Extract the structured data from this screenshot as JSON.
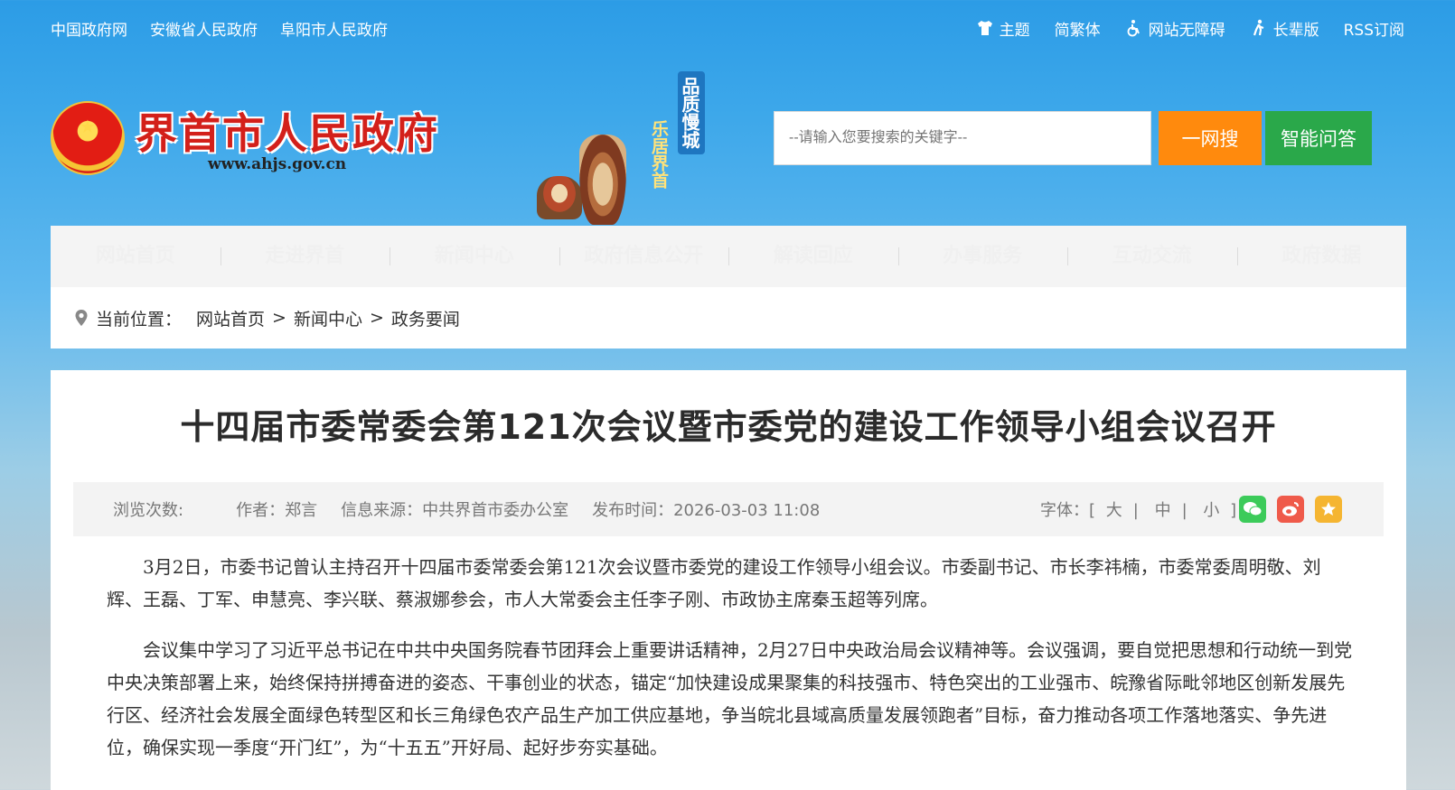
{
  "topbar": {
    "links": [
      "中国政府网",
      "安徽省人民政府",
      "阜阳市人民政府"
    ],
    "tools": [
      {
        "icon": "tshirt-icon",
        "label": "主题"
      },
      {
        "icon": "",
        "label": "简繁体"
      },
      {
        "icon": "wheelchair-icon",
        "label": "网站无障碍"
      },
      {
        "icon": "elder-icon",
        "label": "长辈版"
      },
      {
        "icon": "",
        "label": "RSS订阅"
      }
    ]
  },
  "header": {
    "site_name": "界首市人民政府",
    "site_url": "www.ahjs.gov.cn",
    "slogan_1": "品质慢城",
    "slogan_2": "乐居界首",
    "search_placeholder": "--请输入您要搜索的关键字--",
    "search_button": "一网搜",
    "qa_button": "智能问答"
  },
  "nav": {
    "items": [
      "网站首页",
      "走进界首",
      "新闻中心",
      "政府信息公开",
      "解读回应",
      "办事服务",
      "互动交流",
      "政府数据"
    ]
  },
  "breadcrumb": {
    "prefix": "当前位置：",
    "items": [
      "网站首页",
      "新闻中心",
      "政务要闻"
    ],
    "separator": ">"
  },
  "article": {
    "title": "十四届市委常委会第121次会议暨市委党的建设工作领导小组会议召开",
    "meta": {
      "views": "浏览次数:",
      "author": "作者：郑言",
      "source": "信息来源：中共界首市委办公室",
      "published": "发布时间：2026-03-03 11:08",
      "font_label": "字体：[",
      "font_large": "大",
      "font_medium": "中",
      "font_small": "小",
      "font_end": "]",
      "font_sep": "|"
    },
    "paragraphs": [
      "3月2日，市委书记曾认主持召开十四届市委常委会第121次会议暨市委党的建设工作领导小组会议。市委副书记、市长李祎楠，市委常委周明敬、刘辉、王磊、丁军、申慧亮、李兴联、蔡淑娜参会，市人大常委会主任李子刚、市政协主席秦玉超等列席。",
      "会议集中学习了习近平总书记在中共中央国务院春节团拜会上重要讲话精神，2月27日中央政治局会议精神等。会议强调，要自觉把思想和行动统一到党中央决策部署上来，始终保持拼搏奋进的姿态、干事创业的状态，锚定“加快建设成果聚集的科技强市、特色突出的工业强市、皖豫省际毗邻地区创新发展先行区、经济社会发展全面绿色转型区和长三角绿色农产品生产加工供应基地，争当皖北县域高质量发展领跑者”目标，奋力推动各项工作落地落实、争先进位，确保实现一季度“开门红”，为“十五五”开好局、起好步夯实基础。"
    ]
  },
  "colors": {
    "search_button": "#ff8a0d",
    "qa_button": "#2aa84a",
    "site_name": "#d3201a"
  }
}
